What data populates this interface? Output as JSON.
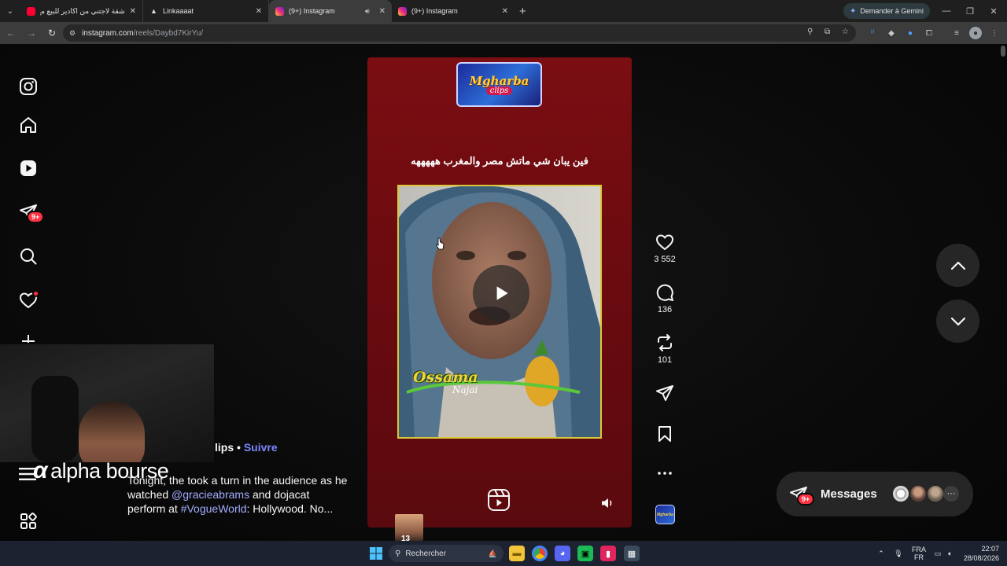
{
  "browser": {
    "tabs": [
      {
        "title": "شقة لاجتني من اكادير للبيع مع ان",
        "active": false,
        "favicon_color": "#ff0033"
      },
      {
        "title": "Linkaaaat",
        "active": false,
        "favicon_color": "#dddddd"
      },
      {
        "title": "(9+) Instagram",
        "active": true,
        "favicon_color": "#e1306c"
      },
      {
        "title": "(9+) Instagram",
        "active": false,
        "favicon_color": "#e1306c"
      }
    ],
    "gemini_label": "Demander à Gemini",
    "url_host": "instagram.com",
    "url_path": "/reels/Daybd7KirYu/"
  },
  "sidebar": {
    "icons": [
      "instagram-logo-icon",
      "home-icon",
      "reels-icon",
      "direct-icon",
      "search-icon",
      "heart-icon",
      "create-icon",
      "more-icon"
    ],
    "direct_badge": "9+"
  },
  "reel": {
    "logo_line1": "Mgharba",
    "logo_line2": "clips",
    "caption": "فين يبان شي ماتش مصر والمغرب هههههه",
    "watermark_name": "Ossama",
    "watermark_sub": "Najai",
    "author": "lips",
    "separator": "•",
    "follow_label": "Suivre",
    "description_parts": {
      "p1": "Tonight, the took a turn in the audience as he watched ",
      "mention1": "@gracieabrams",
      "p2": " and dojacat perform at ",
      "mention2": "#VogueWorld",
      "p3": ": Hollywood. No..."
    }
  },
  "actions": {
    "likes": "3 552",
    "comments": "136",
    "reposts": "101"
  },
  "messages": {
    "label": "Messages",
    "badge": "9+"
  },
  "overlay": {
    "brand": "alpha bourse"
  },
  "taskbar": {
    "search_placeholder": "Rechercher",
    "lang_top": "FRA",
    "lang_bottom": "FR",
    "time": "22:07",
    "date": "28/08/2026",
    "thumb_label": "13"
  },
  "colors": {
    "accent_blue": "#7c86ff",
    "badge_red": "#ff3040",
    "reel_bg": "#6d0b10"
  }
}
